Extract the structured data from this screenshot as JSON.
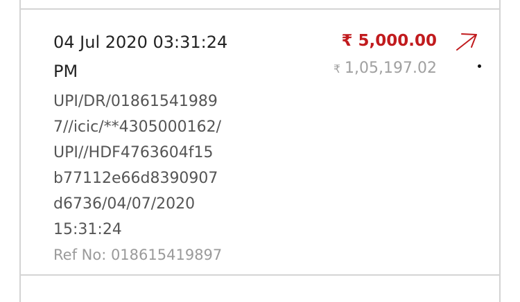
{
  "transaction": {
    "date": "04 Jul 2020 03:31:24 PM",
    "description_lines": [
      "UPI/DR/01861541989",
      "7//icic/**4305000162/",
      "UPI//HDF4763604f15",
      "b77112e66d8390907",
      "d6736/04/07/2020",
      "15:31:24"
    ],
    "reference": "Ref No: 018615419897",
    "amount": "5,000.00",
    "amount_currency_symbol": "₹",
    "balance": "1,05,197.02",
    "balance_currency_symbol": "₹",
    "direction_icon": "arrow-up-right-icon",
    "amount_color": "#c11b1e"
  }
}
